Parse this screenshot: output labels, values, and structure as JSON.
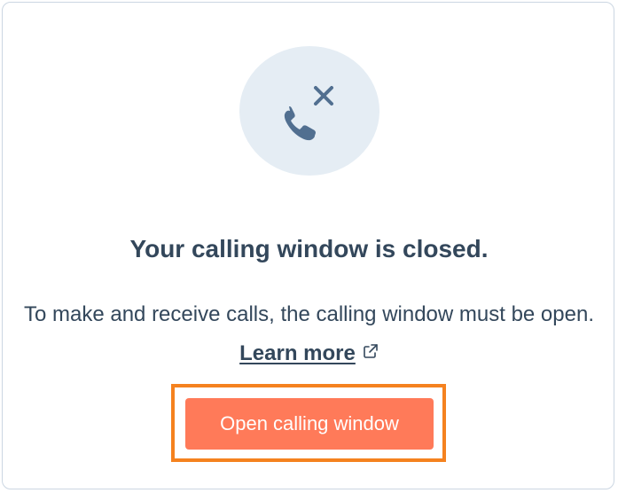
{
  "empty_state": {
    "icon": "phone-call-closed-icon",
    "heading": "Your calling window is closed.",
    "description": "To make and receive calls, the calling window must be open.",
    "learn_more_link": "Learn more",
    "link_icon": "external-link-icon"
  },
  "actions": {
    "open_button_label": "Open calling window",
    "highlight_color": "#f5821f"
  },
  "colors": {
    "primary_button": "#ff7a59",
    "text": "#33475b",
    "icon": "#516f90",
    "icon_background": "#e5edf4"
  }
}
